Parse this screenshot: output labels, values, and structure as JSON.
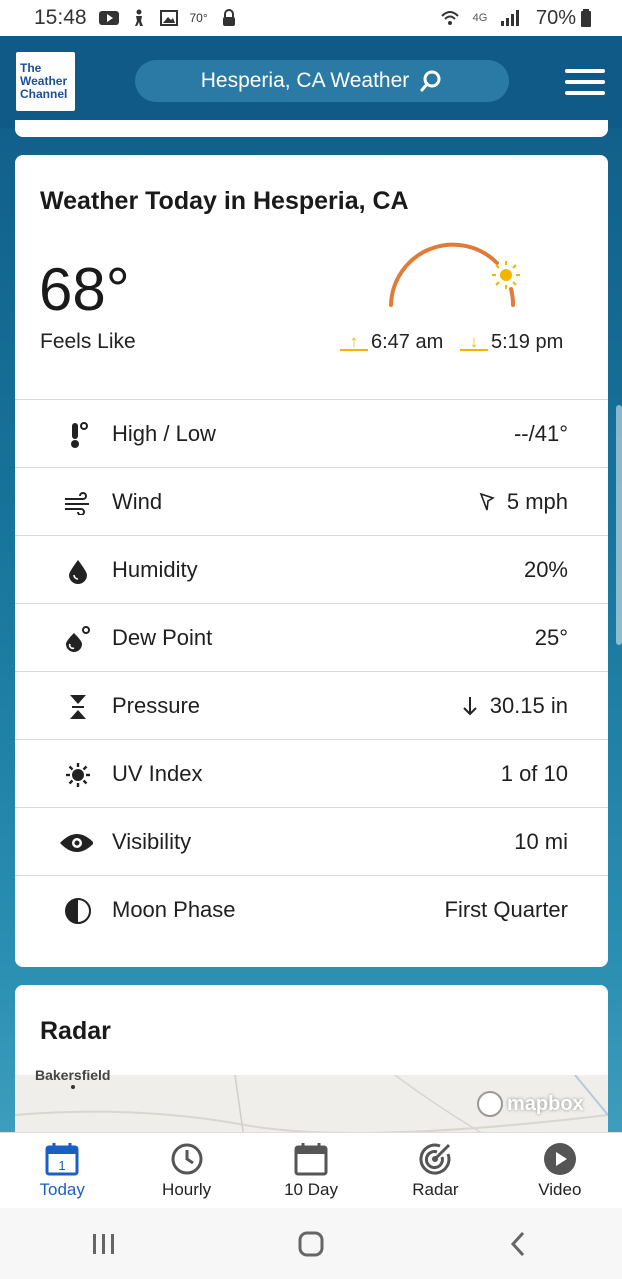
{
  "status_bar": {
    "time": "15:48",
    "temp_badge": "70°",
    "network": "4G",
    "battery": "70%"
  },
  "header": {
    "logo_lines": [
      "The",
      "Weather",
      "Channel"
    ],
    "search_text": "Hesperia, CA Weather",
    "colors": {
      "header_bg": "#0f5a86",
      "pill_bg": "#2b7aa6"
    }
  },
  "today": {
    "title": "Weather Today in Hesperia, CA",
    "temperature": "68°",
    "feels_like_label": "Feels Like",
    "sunrise": "6:47 am",
    "sunset": "5:19 pm",
    "details": [
      {
        "icon": "thermometer-icon",
        "label": "High / Low",
        "value": "--/41°"
      },
      {
        "icon": "wind-icon",
        "label": "Wind",
        "value": "5 mph",
        "value_icon": "wind-direction-icon"
      },
      {
        "icon": "humidity-icon",
        "label": "Humidity",
        "value": "20%"
      },
      {
        "icon": "dew-point-icon",
        "label": "Dew Point",
        "value": "25°"
      },
      {
        "icon": "pressure-icon",
        "label": "Pressure",
        "value": "30.15 in",
        "value_icon": "arrow-down-icon"
      },
      {
        "icon": "uv-index-icon",
        "label": "UV Index",
        "value": "1 of 10"
      },
      {
        "icon": "visibility-icon",
        "label": "Visibility",
        "value": "10 mi"
      },
      {
        "icon": "moon-phase-icon",
        "label": "Moon Phase",
        "value": "First Quarter"
      }
    ]
  },
  "radar": {
    "title": "Radar",
    "map_city": "Bakersfield",
    "attribution": "mapbox"
  },
  "tabs": [
    {
      "label": "Today",
      "icon": "calendar-today-icon",
      "active": true,
      "day_number": "1"
    },
    {
      "label": "Hourly",
      "icon": "clock-icon",
      "active": false
    },
    {
      "label": "10 Day",
      "icon": "calendar-icon",
      "active": false
    },
    {
      "label": "Radar",
      "icon": "radar-icon",
      "active": false
    },
    {
      "label": "Video",
      "icon": "play-icon",
      "active": false
    }
  ],
  "accent_color": "#1a5fc2"
}
